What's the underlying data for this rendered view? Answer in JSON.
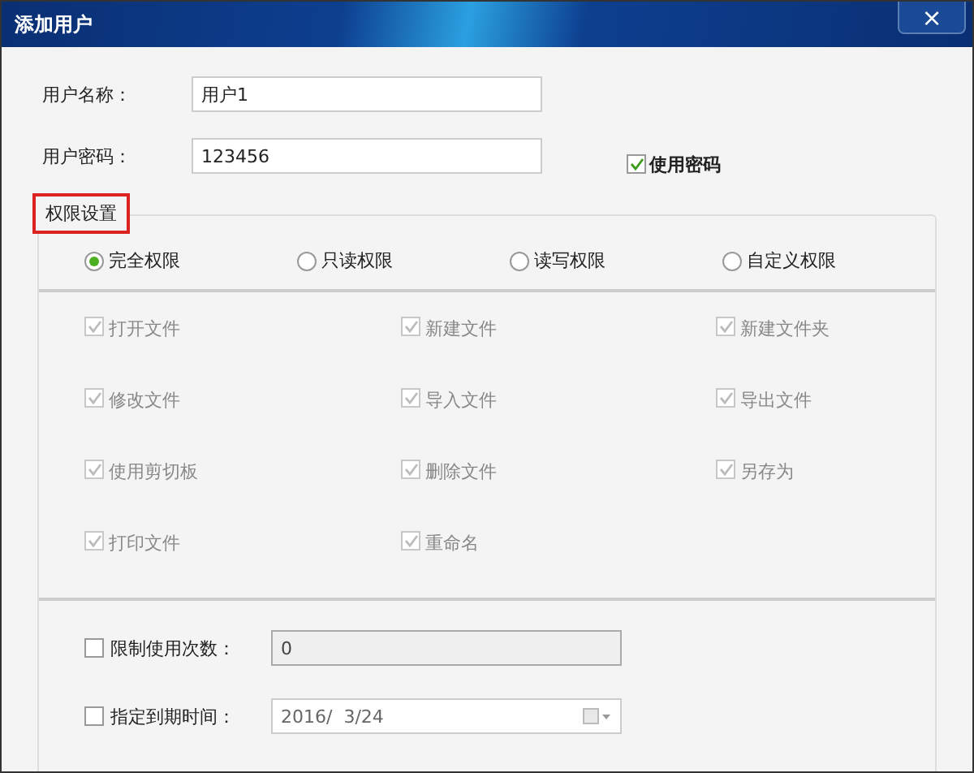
{
  "window": {
    "title": "添加用户",
    "close": "×"
  },
  "fields": [
    {
      "label": "用户名称：",
      "value": "用户1"
    },
    {
      "label": "用户密码：",
      "value": "123456"
    }
  ],
  "use_password": {
    "label": "使用密码",
    "checked": true
  },
  "section_title": "权限设置",
  "modes": [
    {
      "label": "完全权限",
      "selected": true
    },
    {
      "label": "只读权限",
      "selected": false
    },
    {
      "label": "读写权限",
      "selected": false
    },
    {
      "label": "自定义权限",
      "selected": false
    }
  ],
  "permissions": [
    {
      "label": "打开文件",
      "checked": true,
      "disabled": true
    },
    {
      "label": "新建文件",
      "checked": true,
      "disabled": true
    },
    {
      "label": "新建文件夹",
      "checked": true,
      "disabled": true
    },
    {
      "label": "修改文件",
      "checked": true,
      "disabled": true
    },
    {
      "label": "导入文件",
      "checked": true,
      "disabled": true
    },
    {
      "label": "导出文件",
      "checked": true,
      "disabled": true
    },
    {
      "label": "使用剪切板",
      "checked": true,
      "disabled": true
    },
    {
      "label": "删除文件",
      "checked": true,
      "disabled": true
    },
    {
      "label": "另存为",
      "checked": true,
      "disabled": true
    },
    {
      "label": "打印文件",
      "checked": true,
      "disabled": true
    },
    {
      "label": "重命名",
      "checked": true,
      "disabled": true
    }
  ],
  "limits": [
    {
      "kind": "count",
      "label": "限制使用次数：",
      "checked": false,
      "value": "0",
      "disabled": true
    },
    {
      "kind": "date",
      "label": "指定到期时间：",
      "checked": false,
      "value": "2016/  3/24",
      "disabled": false
    }
  ]
}
